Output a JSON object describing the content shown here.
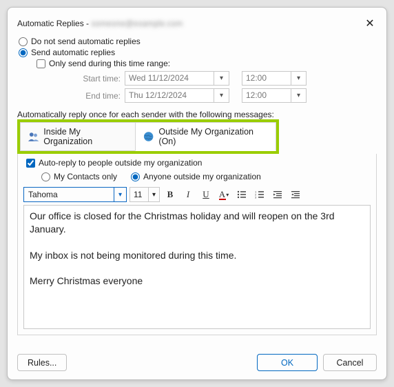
{
  "title_prefix": "Automatic Replies - ",
  "title_blur": "someone@example.com",
  "opt_dont_send": "Do not send automatic replies",
  "opt_send": "Send automatic replies",
  "opt_range": "Only send during this time range:",
  "start_label": "Start time:",
  "end_label": "End time:",
  "start_date": "Wed 11/12/2024",
  "end_date": "Thu 12/12/2024",
  "start_time": "12:00",
  "end_time": "12:00",
  "section_label": "Automatically reply once for each sender with the following messages:",
  "tab_inside": "Inside My Organization",
  "tab_outside": "Outside My Organization (On)",
  "chk_autoreply_outside": "Auto-reply to people outside my organization",
  "rdo_contacts": "My Contacts only",
  "rdo_anyone": "Anyone outside my organization",
  "font_name": "Tahoma",
  "font_size": "11",
  "message_body": "Our office is closed for the Christmas holiday and will reopen on the 3rd January.\n\nMy inbox is not being monitored during this time.\n\nMerry Christmas everyone",
  "btn_rules": "Rules...",
  "btn_ok": "OK",
  "btn_cancel": "Cancel"
}
